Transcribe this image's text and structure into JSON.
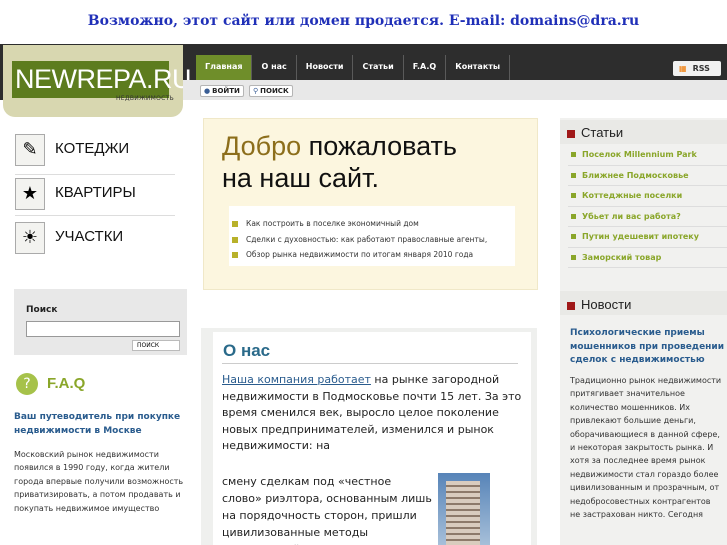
{
  "banner": "Возможно, этот сайт или домен продается. E-mail: domains@dra.ru",
  "logo": {
    "text": "NEWREPA.RU",
    "sub": "НЕДВИЖИМОСТЬ"
  },
  "nav": [
    {
      "label": "Главная",
      "active": true
    },
    {
      "label": "О нас"
    },
    {
      "label": "Новости"
    },
    {
      "label": "Статьи"
    },
    {
      "label": "F.A.Q"
    },
    {
      "label": "Контакты"
    }
  ],
  "rss": "RSS",
  "login": {
    "enter": "ВОЙТИ",
    "search": "ПОИСК"
  },
  "categories": [
    "КОТЕДЖИ",
    "КВАРТИРЫ",
    "УЧАСТКИ"
  ],
  "search": {
    "title": "Поиск",
    "button": "ПОИСК",
    "value": ""
  },
  "faq": {
    "title": "F.A.Q",
    "heading": "Ваш путеводитель при покупке недвижимости в Москве",
    "text": "Московский рынок недвижимости появился в 1990 году, когда жители города впервые получили возможность приватизировать, а потом продавать и покупать недвижимое имущество"
  },
  "welcome": {
    "line1_a": "Добро",
    "line1_b": " пожаловать",
    "line2": "на наш сайт.",
    "items": [
      "Как построить в поселке экономичный дом",
      "Сделки с духовностью: как работают православные агенты,",
      "Обзор рынка недвижимости по итогам января 2010 года"
    ]
  },
  "about": {
    "title": "О нас",
    "link": "Наша компания работает",
    "text1": " на рынке загородной недвижимости в Подмосковье почти 15 лет. За это время сменился век, выросло целое поколение новых предпринимателей, изменился и рынок недвижимости: на",
    "text2": "смену сделкам под «честное слово» риэлтора, основанным лишь на порядочность сторон, пришли цивилизованные методы юридической"
  },
  "articles": {
    "title": "Статьи",
    "items": [
      "Поселок Millennium Park",
      "Ближнее Подмосковье",
      "Коттеджные поселки",
      "Убьет ли вас работа?",
      "Путин удешевит ипотеку",
      "Заморский товар"
    ]
  },
  "news": {
    "title": "Новости",
    "heading": "Психологические приемы мошенников при проведении сделок с недвижимостью",
    "text": "Традиционно рынок недвижимости притягивает значительное количество мошенников. Их привлекают большие деньги, оборачивающиеся в данной сфере, и некоторая закрытость рынка. И хотя за последнее время рынок недвижимости стал гораздо более цивилизованным и прозрачным, от недобросовестных контрагентов не застрахован никто. Сегодня"
  }
}
